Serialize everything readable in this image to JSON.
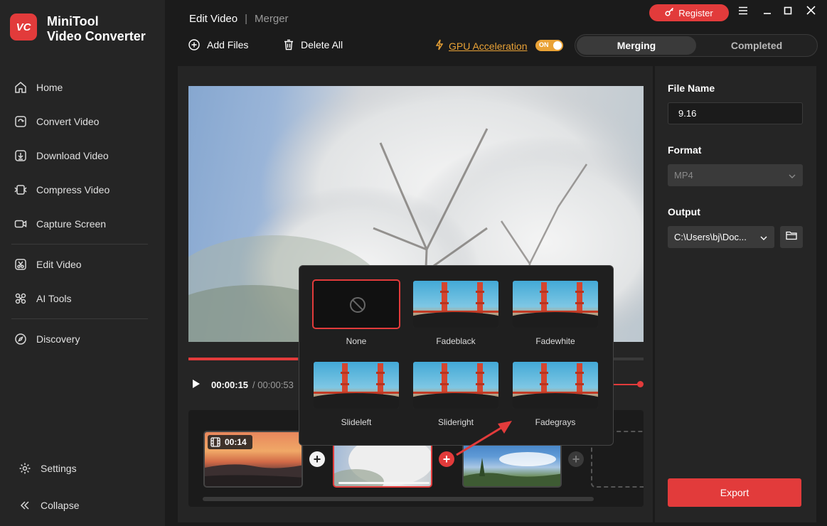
{
  "app": {
    "logo_text": "VC",
    "name_line1": "MiniTool",
    "name_line2": "Video Converter",
    "accent": "#e23b3b"
  },
  "sidebar": {
    "items": [
      {
        "label": "Home",
        "icon": "home-icon"
      },
      {
        "label": "Convert Video",
        "icon": "convert-icon"
      },
      {
        "label": "Download Video",
        "icon": "download-icon"
      },
      {
        "label": "Compress Video",
        "icon": "compress-icon"
      },
      {
        "label": "Capture Screen",
        "icon": "camera-icon"
      },
      {
        "label": "Edit Video",
        "icon": "scissors-icon"
      },
      {
        "label": "AI Tools",
        "icon": "ai-icon"
      },
      {
        "label": "Discovery",
        "icon": "compass-icon"
      }
    ],
    "settings_label": "Settings",
    "collapse_label": "Collapse"
  },
  "header": {
    "crumb_primary": "Edit Video",
    "crumb_secondary": "Merger",
    "register_label": "Register",
    "add_files_label": "Add Files",
    "delete_all_label": "Delete All",
    "gpu_label": "GPU Acceleration",
    "gpu_toggle": "ON",
    "tab_merging": "Merging",
    "tab_completed": "Completed"
  },
  "player": {
    "current_time": "00:00:15",
    "total_time": "/ 00:00:53",
    "progress": 0.24
  },
  "timeline": {
    "clips": [
      {
        "duration": "00:14"
      },
      {
        "duration": ""
      },
      {
        "duration": ""
      }
    ]
  },
  "transitions": {
    "items": [
      {
        "label": "None"
      },
      {
        "label": "Fadeblack"
      },
      {
        "label": "Fadewhite"
      },
      {
        "label": "Slideleft"
      },
      {
        "label": "Slideright"
      },
      {
        "label": "Fadegrays"
      }
    ],
    "selected": "None"
  },
  "settings": {
    "file_name_label": "File Name",
    "file_name_value": "9.16",
    "format_label": "Format",
    "format_value": "MP4",
    "output_label": "Output",
    "output_value": "C:\\Users\\bj\\Doc...",
    "export_label": "Export"
  }
}
